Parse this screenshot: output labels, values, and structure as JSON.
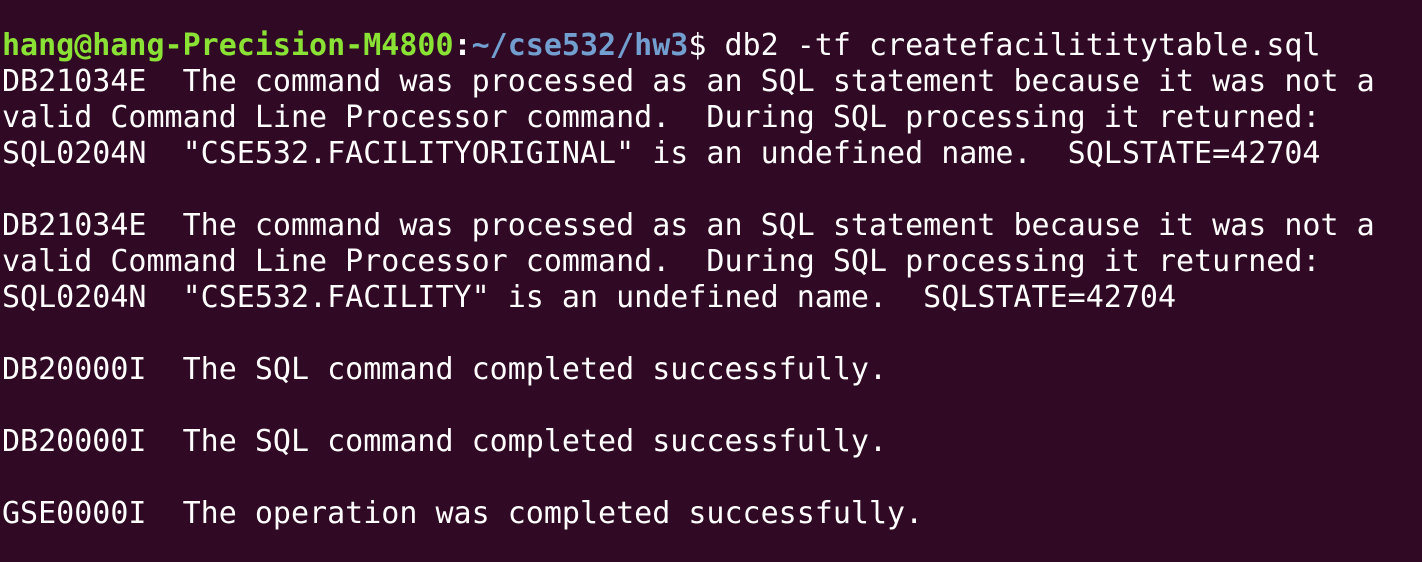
{
  "prompt": {
    "user_host": "hang@hang-Precision-M4800",
    "colon": ":",
    "path": "~/cse532/hw3",
    "symbol": "$",
    "command": " db2 -tf createfacilititytable.sql"
  },
  "output": [
    "DB21034E  The command was processed as an SQL statement because it was not a",
    "valid Command Line Processor command.  During SQL processing it returned:",
    "SQL0204N  \"CSE532.FACILITYORIGINAL\" is an undefined name.  SQLSTATE=42704",
    "",
    "DB21034E  The command was processed as an SQL statement because it was not a",
    "valid Command Line Processor command.  During SQL processing it returned:",
    "SQL0204N  \"CSE532.FACILITY\" is an undefined name.  SQLSTATE=42704",
    "",
    "DB20000I  The SQL command completed successfully.",
    "",
    "DB20000I  The SQL command completed successfully.",
    "",
    "GSE0000I  The operation was completed successfully."
  ],
  "colors": {
    "background": "#300a24",
    "user_host": "#8ae234",
    "path": "#729fcf",
    "text": "#ffffff"
  }
}
